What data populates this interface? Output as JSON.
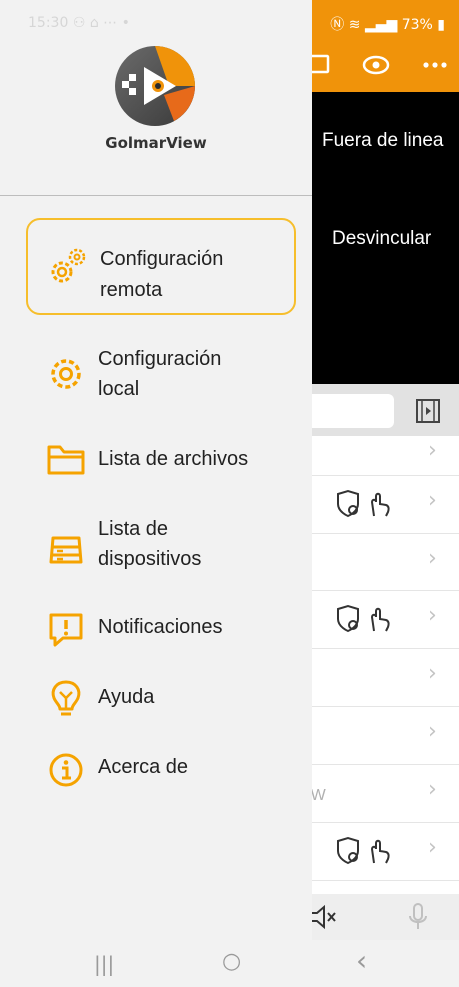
{
  "status_bar": {
    "time": "15:30",
    "battery": "73%"
  },
  "app": {
    "name": "GolmarView"
  },
  "background": {
    "video_labels": {
      "offline": "Fuera de linea",
      "unlink": "Desvincular"
    },
    "list_partial_text": "PW"
  },
  "drawer": {
    "items": [
      {
        "label_line1": "Configuración",
        "label_line2": "remota",
        "icon": "gears-icon",
        "active": true
      },
      {
        "label_line1": "Configuración",
        "label_line2": "local",
        "icon": "gear-icon"
      },
      {
        "label_line1": "Lista de archivos",
        "label_line2": "",
        "icon": "folder-icon"
      },
      {
        "label_line1": "Lista de",
        "label_line2": "dispositivos",
        "icon": "device-list-icon"
      },
      {
        "label_line1": "Notificaciones",
        "label_line2": "",
        "icon": "notification-icon"
      },
      {
        "label_line1": "Ayuda",
        "label_line2": "",
        "icon": "lightbulb-icon"
      },
      {
        "label_line1": "Acerca de",
        "label_line2": "",
        "icon": "info-icon"
      }
    ]
  },
  "colors": {
    "accent": "#F0930A",
    "icon": "#F5A300",
    "active_border": "#F6BE2C"
  },
  "nav": {
    "recent": "|||",
    "home": "○",
    "back": "‹"
  }
}
